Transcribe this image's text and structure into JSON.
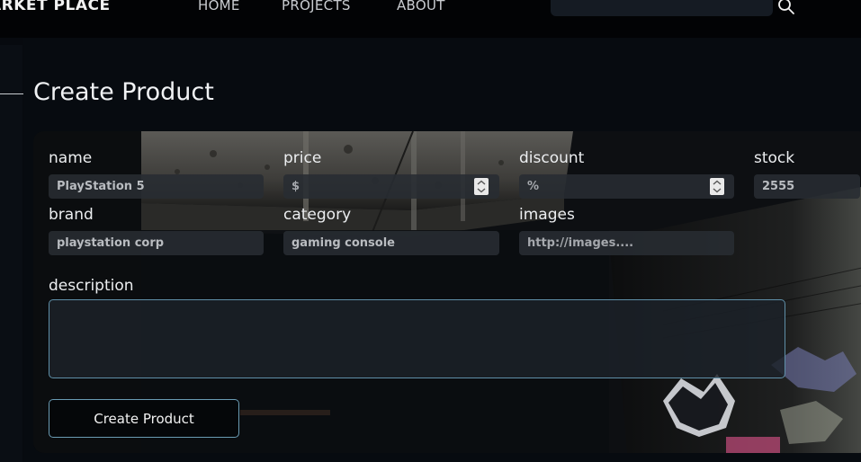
{
  "nav": {
    "brand": "ARKET PLACE",
    "links": [
      "HOME",
      "PROJECTS",
      "ABOUT"
    ],
    "search_icon": "magnifier-icon"
  },
  "page": {
    "title": "Create Product"
  },
  "form": {
    "fields": {
      "name": {
        "label": "name",
        "value": "PlayStation 5"
      },
      "price": {
        "label": "price",
        "placeholder": "$"
      },
      "discount": {
        "label": "discount",
        "placeholder": "%"
      },
      "stock": {
        "label": "stock",
        "value": "2555"
      },
      "brand": {
        "label": "brand",
        "value": "playstation corp"
      },
      "category": {
        "label": "category",
        "value": "gaming console"
      },
      "images": {
        "label": "images",
        "placeholder": "http://images...."
      },
      "description": {
        "label": "description",
        "value": ""
      }
    },
    "submit_label": "Create Product"
  },
  "colors": {
    "background": "#070a0f",
    "accent_border": "#6a9bb3",
    "input_bg": "#282c32"
  }
}
